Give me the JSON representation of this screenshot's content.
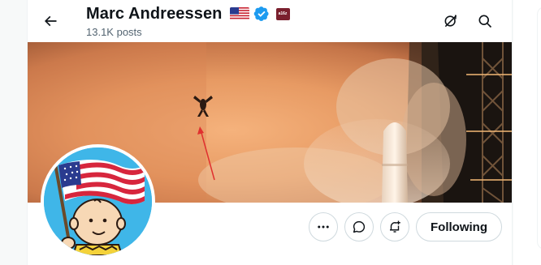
{
  "header": {
    "title": "Marc Andreessen",
    "post_count": "13.1K posts",
    "affiliation_badge_text": "a16z"
  },
  "icons": {
    "back": "back-arrow-icon",
    "verified": "verified-badge-icon",
    "flag": "us-flag-icon",
    "grok": "grok-icon",
    "search": "search-icon",
    "more": "more-icon",
    "message": "message-icon",
    "notify": "notification-bell-icon"
  },
  "colors": {
    "verified_blue": "#1d9bf0",
    "text_primary": "#0f1419",
    "text_secondary": "#536471",
    "border": "#cfd9de",
    "affil_badge": "#7a1f2d"
  },
  "actions": {
    "following_label": "Following"
  }
}
